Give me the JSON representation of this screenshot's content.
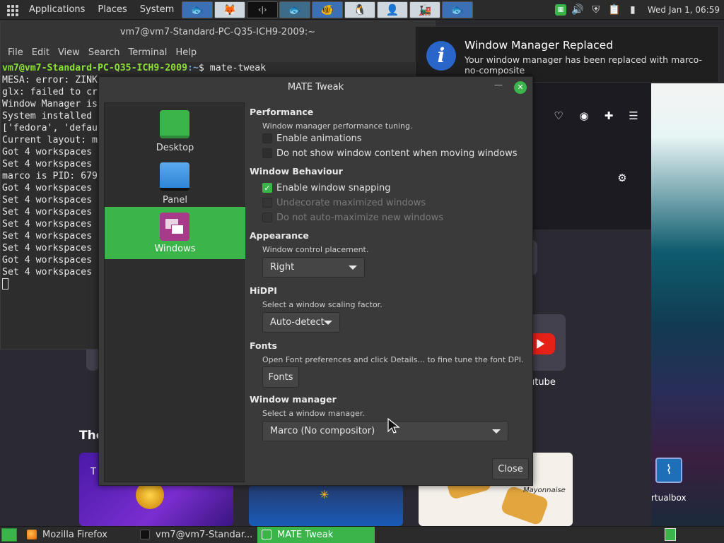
{
  "top_panel": {
    "menus": [
      "Applications",
      "Places",
      "System"
    ],
    "launchers": [
      "fish-icon",
      "gimp-icon",
      "terminal-icon",
      "fish-icon-2",
      "fish-icon-3",
      "penguin-icon",
      "person-icon",
      "train-icon",
      "fish-icon-4"
    ],
    "clock": "Wed Jan 1, 06:59"
  },
  "terminal": {
    "title": "vm7@vm7-Standard-PC-Q35-ICH9-2009:~",
    "menu": [
      "File",
      "Edit",
      "View",
      "Search",
      "Terminal",
      "Help"
    ],
    "prompt_user": "vm7@vm7-Standard-PC-Q35-ICH9-2009",
    "prompt_path": ":~",
    "command": "$ mate-tweak",
    "lines": [
      "MESA: error: ZINK",
      "glx: failed to cr",
      "Window Manager is",
      "System installed",
      "['fedora', 'defau",
      "Current layout: m",
      "Got 4 workspaces",
      "Set 4 workspaces",
      "marco is PID: 679",
      "Got 4 workspaces",
      "Set 4 workspaces",
      "Set 4 workspaces",
      "Set 4 workspaces",
      "Set 4 workspaces",
      "Set 4 workspaces",
      "Got 4 workspaces",
      "Set 4 workspaces"
    ]
  },
  "firefox": {
    "partial_texts": {
      "youtube": "utube",
      "heading": "Tho",
      "mayonnaise": "Mayonnaise",
      "t_letter": "T"
    }
  },
  "notification": {
    "title": "Window Manager Replaced",
    "body": "Your window manager has been replaced with marco-no-composite"
  },
  "tweak": {
    "title": "MATE Tweak",
    "sidebar": [
      {
        "label": "Desktop",
        "color": "#3bb44a"
      },
      {
        "label": "Panel",
        "color": "#2f86d6"
      },
      {
        "label": "Windows",
        "color": "#a83a8a"
      }
    ],
    "performance": {
      "title": "Performance",
      "desc": "Window manager performance tuning.",
      "options": [
        {
          "label": "Enable animations",
          "checked": false,
          "disabled": false
        },
        {
          "label": "Do not show window content when moving windows",
          "checked": false,
          "disabled": false
        }
      ]
    },
    "behaviour": {
      "title": "Window Behaviour",
      "options": [
        {
          "label": "Enable window snapping",
          "checked": true,
          "disabled": false
        },
        {
          "label": "Undecorate maximized windows",
          "checked": false,
          "disabled": true
        },
        {
          "label": "Do not auto-maximize new windows",
          "checked": false,
          "disabled": true
        }
      ]
    },
    "appearance": {
      "title": "Appearance",
      "desc": "Window control placement.",
      "value": "Right"
    },
    "hidpi": {
      "title": "HiDPI",
      "desc": "Select a window scaling factor.",
      "value": "Auto-detect"
    },
    "fonts": {
      "title": "Fonts",
      "desc": "Open Font preferences and click Details... to fine tune the font DPI.",
      "button": "Fonts"
    },
    "wm": {
      "title": "Window manager",
      "desc": "Select a window manager.",
      "value": "Marco (No compositor)"
    },
    "close": "Close"
  },
  "wallpaper": {
    "virtualbox_label": "rtualbox"
  },
  "taskbar": {
    "tasks": [
      {
        "label": "Mozilla Firefox"
      },
      {
        "label": "vm7@vm7-Standar..."
      },
      {
        "label": "MATE Tweak"
      }
    ]
  }
}
